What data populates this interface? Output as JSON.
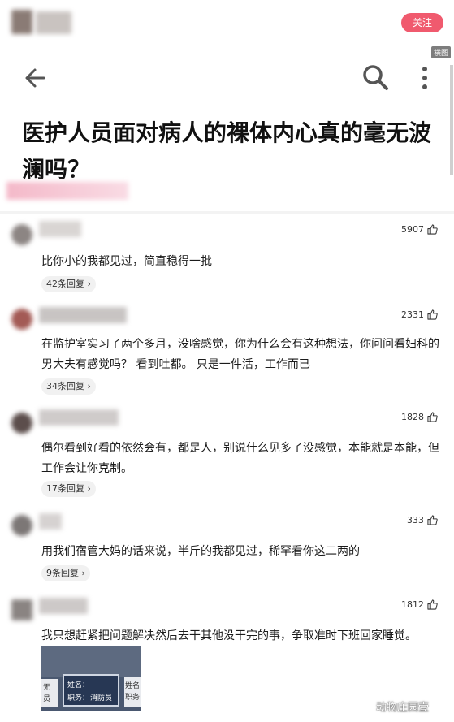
{
  "header": {
    "follow_label": "关注",
    "tag_label": "横图"
  },
  "article": {
    "title": "医护人员面对病人的裸体内心真的毫无波澜吗？"
  },
  "comments": [
    {
      "text": "比你小的我都见过，简直稳得一批",
      "likes": "5907",
      "replies": "42条回复 ›"
    },
    {
      "text": "在监护室实习了两个多月，没啥感觉，你为什么会有这种想法，你问问看妇科的男大夫有感觉吗？  看到吐都。  只是一件活，工作而已",
      "likes": "2331",
      "replies": "34条回复 ›"
    },
    {
      "text": "偶尔看到好看的依然会有，都是人，别说什么见多了没感觉，本能就是本能，但工作会让你克制。",
      "likes": "1828",
      "replies": "17条回复 ›"
    },
    {
      "text": "用我们宿管大妈的话来说，半斤的我都见过，稀罕看你这二两的",
      "likes": "333",
      "replies": "9条回复 ›"
    },
    {
      "text": "我只想赶紧把问题解决然后去干其他没干完的事，争取准时下班回家睡觉。",
      "likes": "1812",
      "replies": ""
    }
  ],
  "photo": {
    "left_text": "无\n员",
    "card_name": "姓名：",
    "card_role": "职务：",
    "card_value": "消防员",
    "right_text": "姓名\n职务"
  },
  "watermark": "动物庄园壹",
  "colors": {
    "follow_button": "#f05a6e",
    "reply_pill": "#f1f1f1"
  }
}
